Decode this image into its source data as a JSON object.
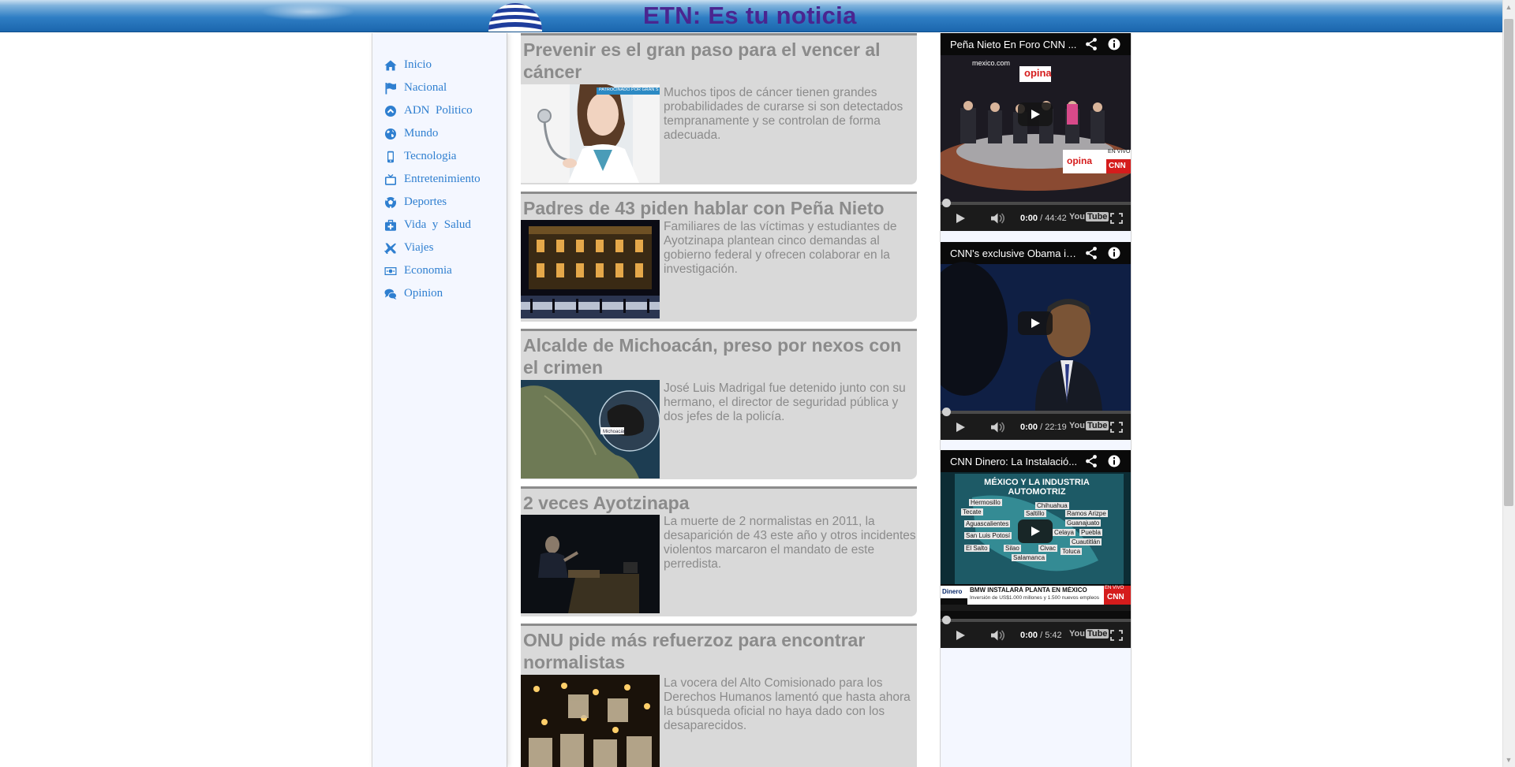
{
  "site": {
    "title": "ETN: Es tu noticia"
  },
  "nav": {
    "items": [
      {
        "label": "Inicio",
        "icon": "home-icon"
      },
      {
        "label": "Nacional",
        "icon": "flag-icon"
      },
      {
        "label": "ADN  Politico",
        "icon": "circle-chevron-icon"
      },
      {
        "label": "Mundo",
        "icon": "globe-icon"
      },
      {
        "label": "Tecnologia",
        "icon": "mobile-phone-icon"
      },
      {
        "label": "Entretenimiento",
        "icon": "tv-icon"
      },
      {
        "label": "Deportes",
        "icon": "soccer-ball-icon"
      },
      {
        "label": "Vida  y  Salud",
        "icon": "medkit-icon"
      },
      {
        "label": "Viajes",
        "icon": "plane-icon"
      },
      {
        "label": "Economia",
        "icon": "money-icon"
      },
      {
        "label": "Opinion",
        "icon": "comments-icon"
      }
    ],
    "link_color": "#2f7fd0"
  },
  "articles": [
    {
      "title": "Prevenir es el gran paso para el vencer al cáncer",
      "summary": "Muchos tipos de cáncer tienen grandes probabilidades de curarse si son detectados tempranamente y se controlan de forma adecuada.",
      "thumb_badge": "PATROCINADO POR GRAN SEGUROS"
    },
    {
      "title": "Padres de 43 piden hablar con Peña Nieto",
      "summary": "Familiares de las víctimas y estudiantes de Ayotzinapa plantean cinco demandas al gobierno federal y ofrecen colaborar en la investigación."
    },
    {
      "title": "Alcalde de Michoacán, preso por nexos con el crimen",
      "summary": "José Luis Madrigal fue detenido junto con su hermano, el director de seguridad pública y dos jefes de la policía.",
      "thumb_label": "Michoacán"
    },
    {
      "title": "2 veces Ayotzinapa",
      "summary": "La muerte de 2 normalistas en 2011, la desaparición de 43 este año y otros incidentes violentos marcaron el mandato de este perredista."
    },
    {
      "title": "ONU pide más refuerzoz para encontrar normalistas",
      "summary": "La vocera del Alto Comisionado para los Derechos Humanos lamentó que hasta ahora la búsqueda oficial no haya dado con los desaparecidos."
    }
  ],
  "videos": [
    {
      "title": "Peña Nieto En Foro CNN ...",
      "time_current": "0:00",
      "duration": "/ 44:42",
      "overlay_top": "mexico.com",
      "overlay_brand": "opina",
      "overlay_live": "EN VIVO",
      "overlay_channel": "CNN"
    },
    {
      "title": "CNN's exclusive Obama in...",
      "time_current": "0:00",
      "duration": "/ 22:19"
    },
    {
      "title": "CNN Dinero: La Instalació...",
      "time_current": "0:00",
      "duration": "/ 5:42",
      "overlay_headline": "MÉXICO Y LA INDUSTRIA AUTOMOTRIZ",
      "cities": [
        "Hermosillo",
        "Tecate",
        "Chihuahua",
        "Saltillo",
        "Ramos Arizpe",
        "Aguascalientes",
        "Guanajuato",
        "San Luis Potosí",
        "Celaya",
        "Puebla",
        "Cuautitlán",
        "El Salto",
        "Silao",
        "Toluca",
        "Salamanca",
        "Civac"
      ],
      "overlay_ticker": "BMW INSTALARÁ PLANTA EN MÉXICO",
      "overlay_ticker_sub": "Inversión de US$1.000 millones y 1.500 nuevos empleos",
      "overlay_brand": "Dinero",
      "overlay_live": "EN VIVO",
      "overlay_channel": "CNN"
    }
  ],
  "player": {
    "youtube_label": "You",
    "youtube_label_box": "Tube"
  },
  "colors": {
    "header": "#2f7ec4",
    "title": "#4a2590",
    "card": "#d9d9d9",
    "card_text": "#8b8b8b"
  }
}
